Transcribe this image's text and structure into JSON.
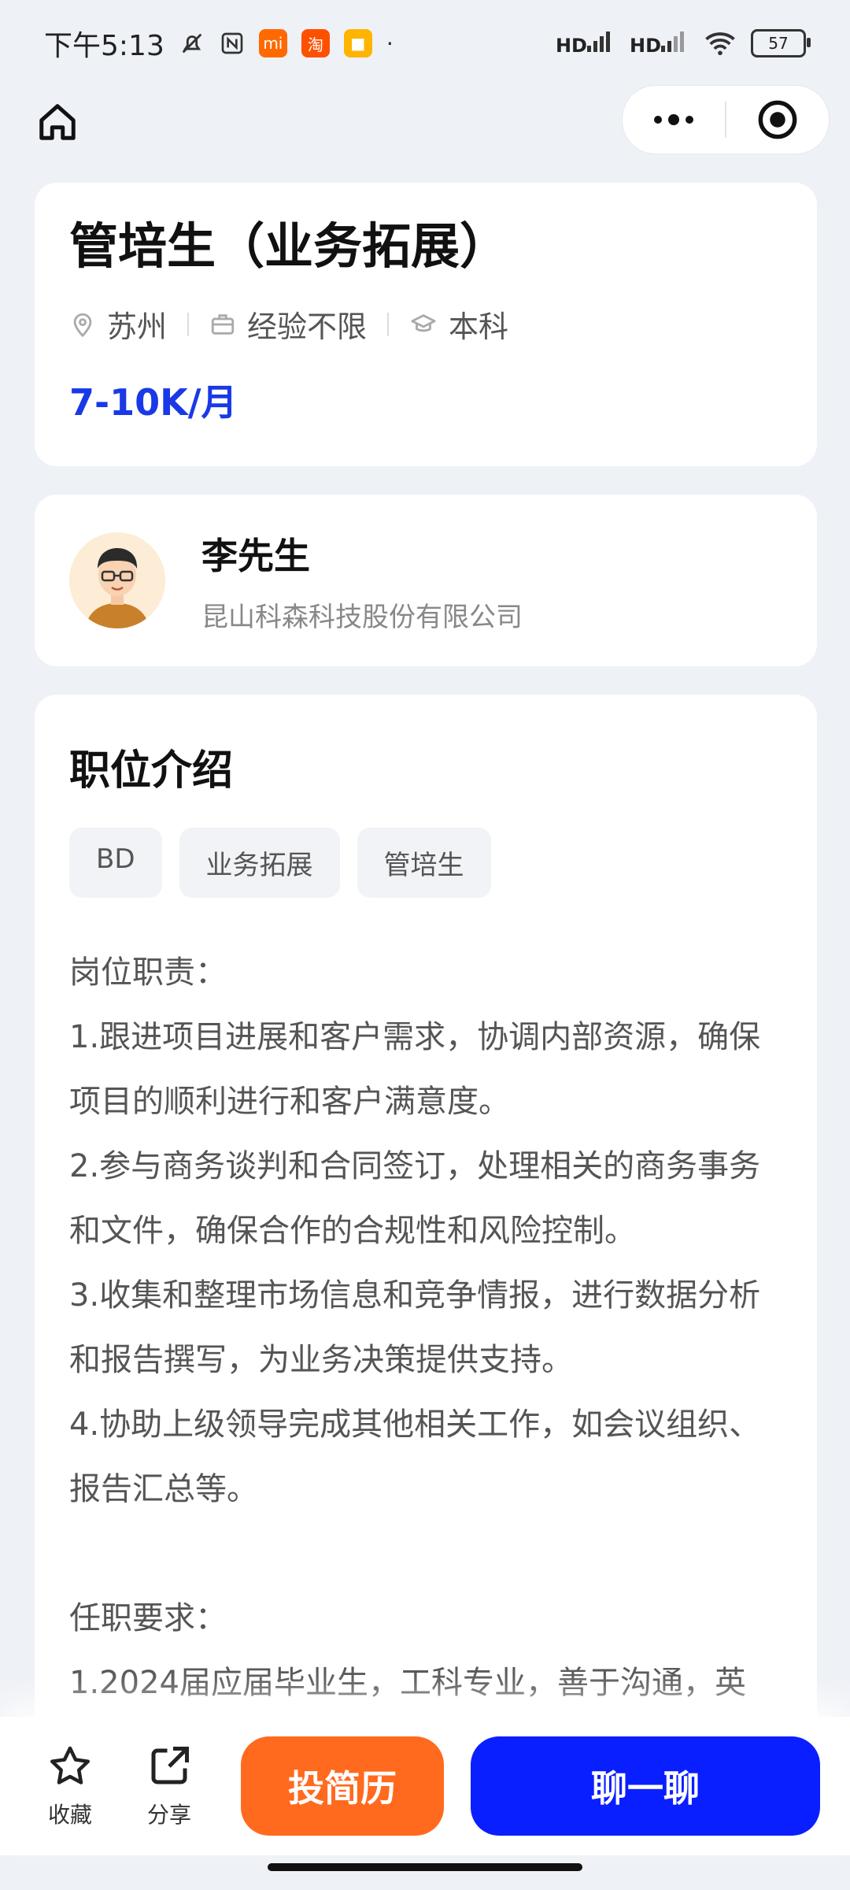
{
  "status_bar": {
    "time": "下午5:13",
    "battery": "57",
    "signal_label_1": "HD",
    "signal_label_2": "HD"
  },
  "job": {
    "title": "管培生（业务拓展）",
    "location": "苏州",
    "experience": "经验不限",
    "education": "本科",
    "salary": "7-10K/月"
  },
  "recruiter": {
    "name": "李先生",
    "company": "昆山科森科技股份有限公司"
  },
  "description": {
    "title": "职位介绍",
    "tags": [
      "BD",
      "业务拓展",
      "管培生"
    ],
    "lines": [
      "岗位职责：",
      "1.跟进项目进展和客户需求，协调内部资源，确保",
      "项目的顺利进行和客户满意度。",
      "2.参与商务谈判和合同签订，处理相关的商务事务",
      "和文件，确保合作的合规性和风险控制。",
      "3.收集和整理市场信息和竞争情报，进行数据分析",
      "和报告撰写，为业务决策提供支持。",
      "4.协助上级领导完成其他相关工作，如会议组织、",
      "报告汇总等。",
      "",
      "任职要求：",
      "1.2024届应届毕业生，工科专业，善于沟通，英"
    ]
  },
  "bottom_bar": {
    "favorite_label": "收藏",
    "share_label": "分享",
    "resume_button": "投简历",
    "chat_button": "聊一聊"
  },
  "colors": {
    "salary": "#1a39e6",
    "resume_button": "#ff6a1e",
    "chat_button": "#0a1fff"
  }
}
